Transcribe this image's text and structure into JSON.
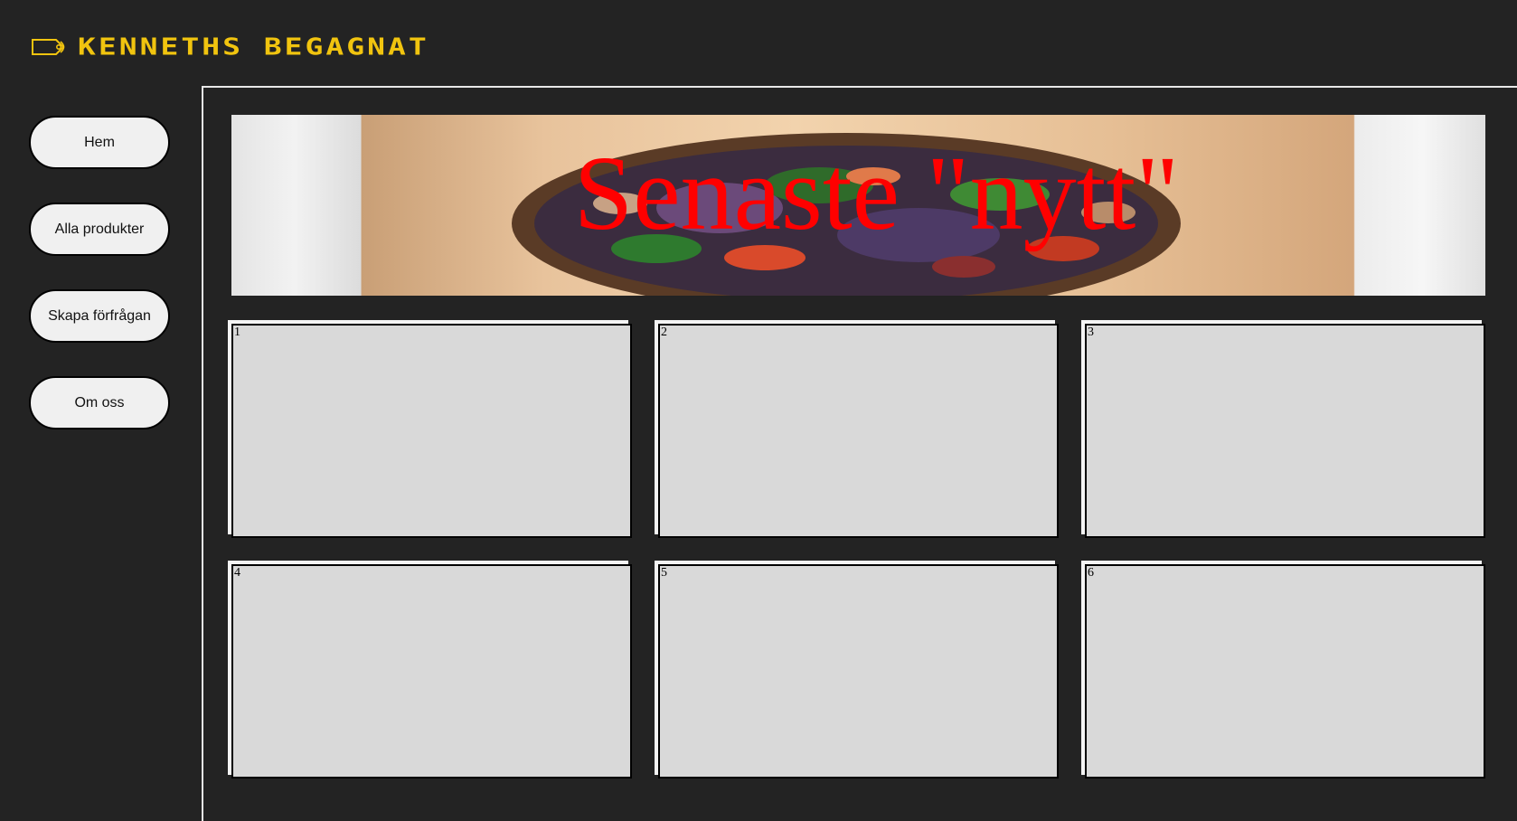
{
  "header": {
    "logo_text": "KENNETHS BEGAGNAT",
    "logo_icon": "price-tag-icon",
    "accent_color": "#f1c40f"
  },
  "nav": {
    "items": [
      {
        "label": "Hem"
      },
      {
        "label": "Alla produkter"
      },
      {
        "label": "Skapa förfrågan"
      },
      {
        "label": "Om oss"
      }
    ]
  },
  "banner": {
    "title": "Senaste \"nytt\"",
    "title_color": "#ff0000"
  },
  "grid": {
    "cells": [
      {
        "number": "1"
      },
      {
        "number": "2"
      },
      {
        "number": "3"
      },
      {
        "number": "4"
      },
      {
        "number": "5"
      },
      {
        "number": "6"
      }
    ]
  }
}
